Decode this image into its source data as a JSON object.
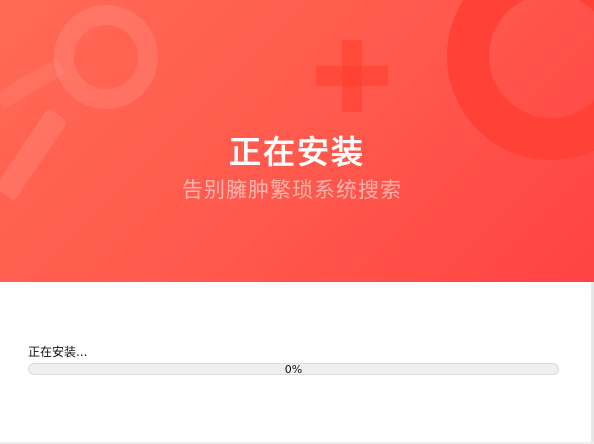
{
  "banner": {
    "title": "正在安装",
    "subtitle": "告别臃肿繁琐系统搜索",
    "accent_color": "#ff5a4d"
  },
  "install": {
    "status_label": "正在安装...",
    "progress_fraction": 0,
    "progress_text": "0%"
  }
}
